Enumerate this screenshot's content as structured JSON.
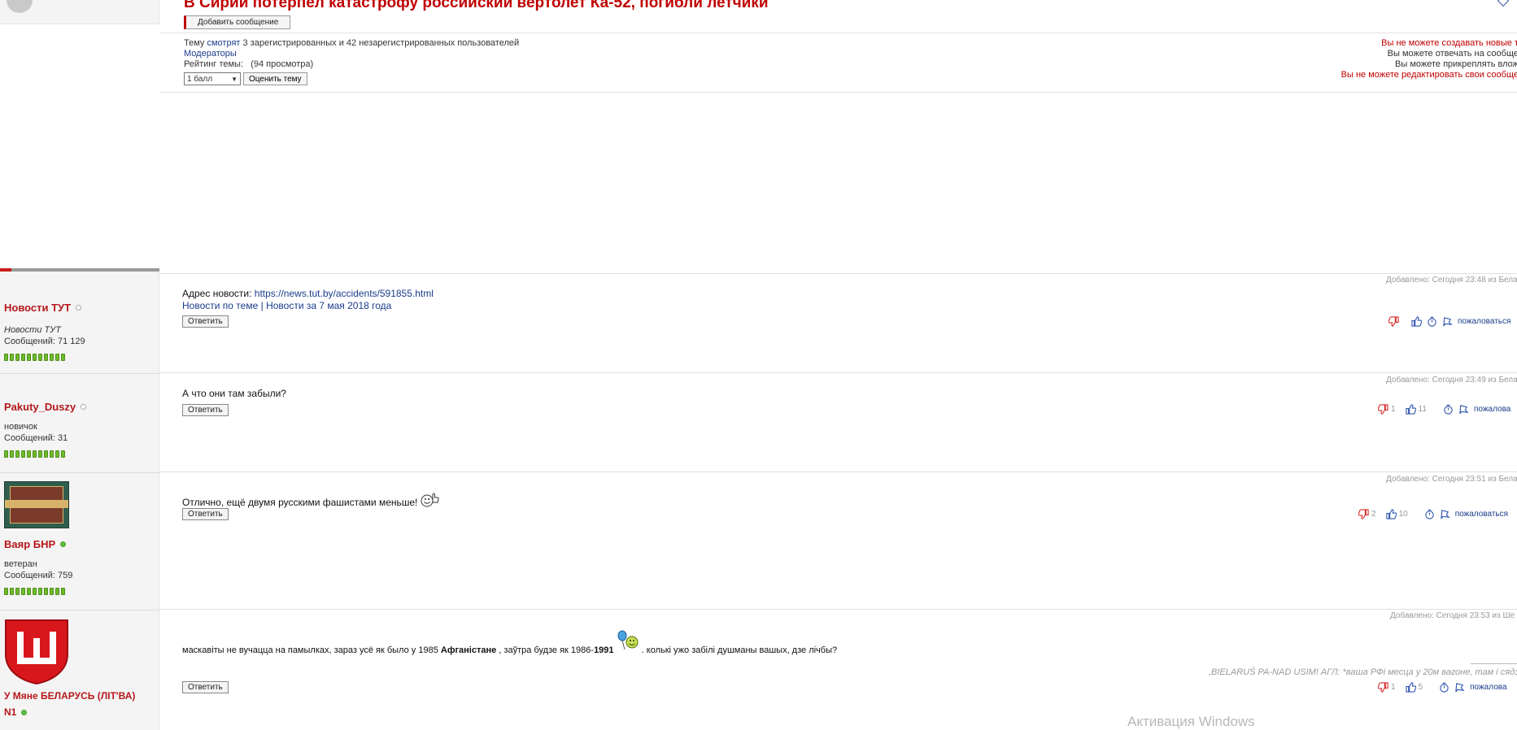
{
  "topic": {
    "title": "В Сирии потерпел катастрофу российский вертолет Ка-52, погибли летчики",
    "add_message_label": "Добавить сообщение",
    "viewers_prefix": "Тему ",
    "viewers_link": "смотрят",
    "viewers_suffix": " 3 зарегистрированных и 42 незарегистрированных пользователей",
    "moderators_label": "Модераторы",
    "rating_label": "Рейтинг темы:",
    "views": "(94 просмотра)",
    "rating_selected": "1 балл",
    "rate_button": "Оценить тему"
  },
  "permissions": [
    {
      "text": "Вы не можете создавать новые т",
      "color": "red"
    },
    {
      "text": "Вы можете отвечать на сообще",
      "color": "normal"
    },
    {
      "text": "Вы можете прикреплять влож",
      "color": "normal"
    },
    {
      "text": "Вы не можете редактировать свои сообще",
      "color": "red"
    }
  ],
  "posts": [
    {
      "author": "Новости ТУТ",
      "rank": "Новости ТУТ",
      "posts_count": "Сообщений: 71 129",
      "online": false,
      "date": "Добавлено: Сегодня 23:48 из Бела",
      "body": {
        "prefix": "Адрес новости: ",
        "link": "https://news.tut.by/accidents/591855.html",
        "line2_a": "Новости по теме",
        "line2_sep": " | ",
        "line2_b": "Новости за 7 мая 2018 года"
      },
      "reply": "Ответить",
      "dislikes": "",
      "likes": "",
      "complain": "пожаловаться"
    },
    {
      "author": "Pakuty_Duszy",
      "rank": "новичок",
      "posts_count": "Сообщений: 31",
      "online": false,
      "date": "Добавлено: Сегодня 23:49 из Бела",
      "body": {
        "text": "А что они там забыли?"
      },
      "reply": "Ответить",
      "dislikes": "1",
      "likes": "11",
      "complain": "пожалова"
    },
    {
      "author": "Ваяр БНР",
      "rank": "ветеран",
      "posts_count": "Сообщений: 759",
      "online": true,
      "date": "Добавлено: Сегодня 23:51 из Бела",
      "body": {
        "text": "Отлично, ещё двумя русскими фашистами меньше!"
      },
      "reply": "Ответить",
      "dislikes": "2",
      "likes": "10",
      "complain": "пожаловаться"
    },
    {
      "author": "У Мяне БЕЛАРУСЬ (ЛІТ'ВА)",
      "author_line2": "N1",
      "online": true,
      "date": "Добавлено: Сегодня 23:53 из Ше",
      "body": {
        "t1": "маскавіты не вучацца на памылках, зараз усё як было у 1985 ",
        "b1": "Афганістане",
        "t2": " , заўтра будзе як 1986-",
        "b2": "1991",
        "t3": " . колькі ужо забілі душманы вашых, дзе лічбы?"
      },
      "signature": ",BIELARUŚ PA-NAD USIM! АГЛ: *ваша РФі месца у 20м вагоне, там і сядз",
      "reply": "Ответить",
      "dislikes": "1",
      "likes": "5",
      "complain": "пожалова"
    }
  ],
  "watermark": "Активация Windows",
  "colors": {
    "accent": "#c00000",
    "link": "#1a3c8c",
    "online": "#5fbf3f"
  }
}
